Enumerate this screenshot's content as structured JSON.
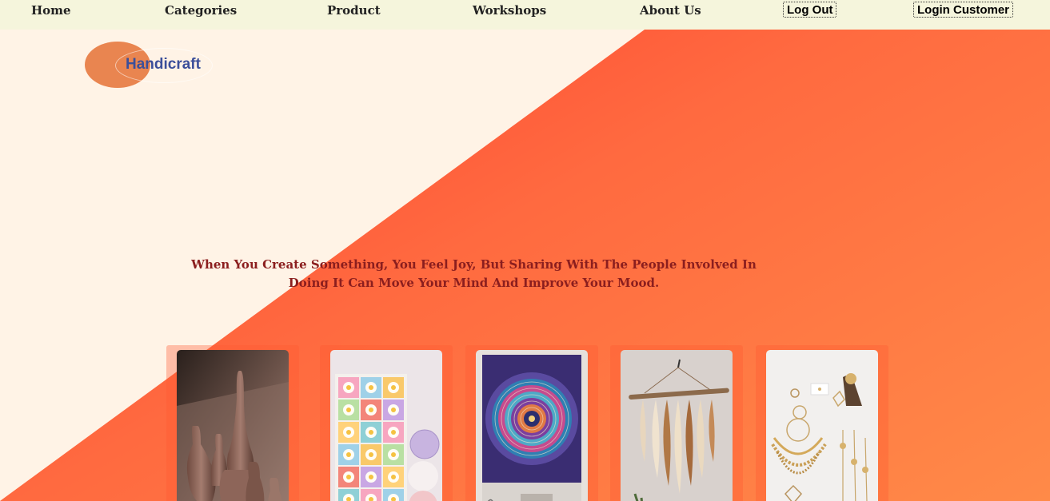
{
  "nav": {
    "home": "Home",
    "categories": "Categories",
    "product": "Product",
    "workshops": "Workshops",
    "about": "About Us",
    "logout": "Log Out",
    "login_customer": "Login Customer"
  },
  "logo": {
    "text": "Handicraft"
  },
  "hero": {
    "tagline": "When You Create Something, You Feel Joy, But Sharing With The People Involved In Doing It Can Move Your Mind And Improve Your Mood."
  },
  "cards": [
    {
      "icon": "pottery-vases-image"
    },
    {
      "icon": "crochet-pillow-image"
    },
    {
      "icon": "mandala-tapestry-image"
    },
    {
      "icon": "macrame-wall-hanging-image"
    },
    {
      "icon": "jewelry-image"
    }
  ],
  "colors": {
    "nav_bg": "#f5f5dc",
    "hero_light": "#fff3e6",
    "hero_accent": "#ff5a3a",
    "tagline": "#8b1e1e",
    "logo_text": "#3b4f9a",
    "logo_ellipse": "#e98550"
  }
}
